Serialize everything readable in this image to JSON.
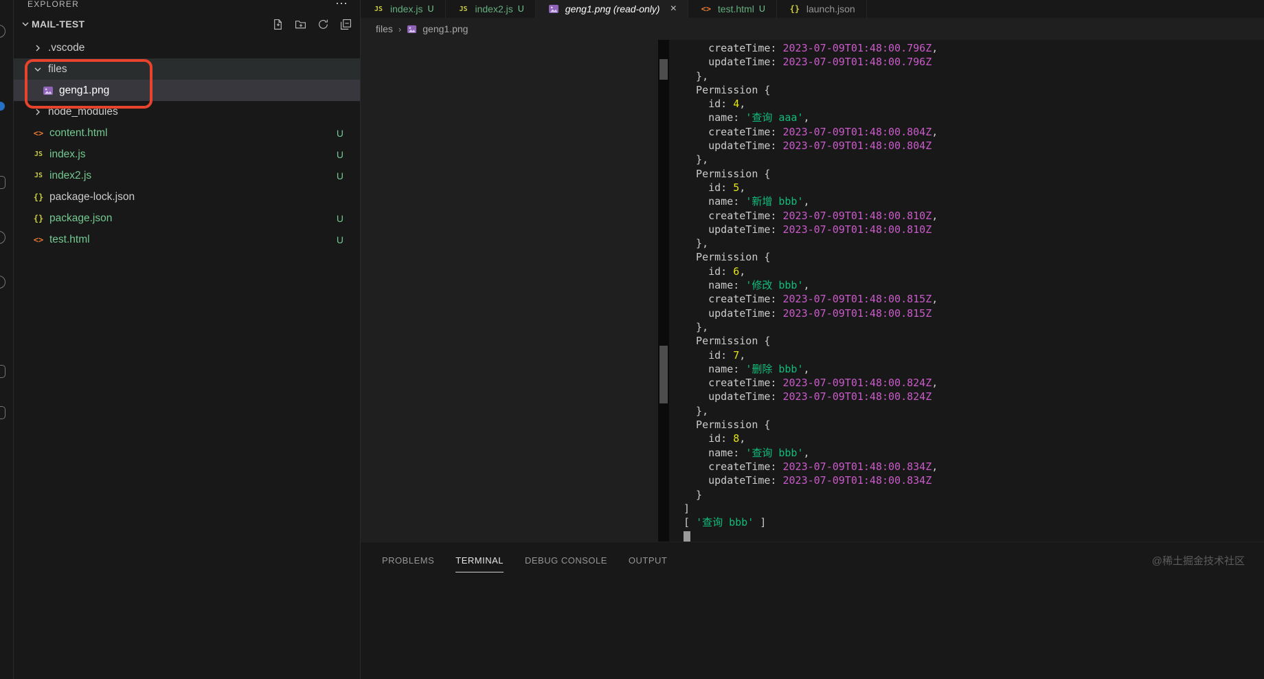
{
  "colors": {
    "untracked_green": "#73C991",
    "ansi_magenta": "#CB5BCB",
    "ansi_yellow": "#E5E510",
    "ansi_green": "#0FBE7C",
    "annotation_red": "#E8432D",
    "activity_badge_blue": "#2472C8",
    "selected_row": "#37373d"
  },
  "sidebar": {
    "header_label": "EXPLORER",
    "header_more": "⋯",
    "section_label": "MAIL-TEST",
    "toolbar": [
      "new-file",
      "new-folder",
      "refresh",
      "collapse-all"
    ],
    "files": [
      {
        "label": ".vscode",
        "type": "folder",
        "expanded": false
      },
      {
        "label": "files",
        "type": "folder",
        "expanded": true,
        "focused": true
      },
      {
        "label": "geng1.png",
        "type": "image",
        "indent": 2,
        "selected": true
      },
      {
        "label": "node_modules",
        "type": "folder",
        "expanded": false
      },
      {
        "label": "content.html",
        "type": "html",
        "badge": "U"
      },
      {
        "label": "index.js",
        "type": "js",
        "badge": "U"
      },
      {
        "label": "index2.js",
        "type": "js",
        "badge": "U"
      },
      {
        "label": "package-lock.json",
        "type": "json"
      },
      {
        "label": "package.json",
        "type": "json",
        "badge": "U"
      },
      {
        "label": "test.html",
        "type": "html",
        "badge": "U"
      }
    ]
  },
  "tabs": [
    {
      "label": "index.js",
      "icon": "js",
      "badge": "U",
      "active": false
    },
    {
      "label": "index2.js",
      "icon": "js",
      "badge": "U",
      "active": false
    },
    {
      "label": "geng1.png (read-only)",
      "icon": "image",
      "close": "×",
      "active": true
    },
    {
      "label": "test.html",
      "icon": "html",
      "badge": "U",
      "active": false
    },
    {
      "label": "launch.json",
      "icon": "json",
      "active": false
    }
  ],
  "breadcrumb": {
    "folder": "files",
    "separator": "›",
    "file": "geng1.png"
  },
  "terminal": {
    "lines": [
      {
        "segs": [
          [
            "f",
            "    createTime: "
          ],
          [
            "m",
            "2023-07-09T01:48:00.796Z"
          ],
          [
            "f",
            ","
          ]
        ]
      },
      {
        "segs": [
          [
            "f",
            "    updateTime: "
          ],
          [
            "m",
            "2023-07-09T01:48:00.796Z"
          ]
        ]
      },
      {
        "segs": [
          [
            "f",
            "  },"
          ]
        ]
      },
      {
        "segs": [
          [
            "f",
            "  Permission {"
          ]
        ]
      },
      {
        "segs": [
          [
            "f",
            "    id: "
          ],
          [
            "y",
            "4"
          ],
          [
            "f",
            ","
          ]
        ]
      },
      {
        "segs": [
          [
            "f",
            "    name: "
          ],
          [
            "g",
            "'查询 aaa'"
          ],
          [
            "f",
            ","
          ]
        ]
      },
      {
        "segs": [
          [
            "f",
            "    createTime: "
          ],
          [
            "m",
            "2023-07-09T01:48:00.804Z"
          ],
          [
            "f",
            ","
          ]
        ]
      },
      {
        "segs": [
          [
            "f",
            "    updateTime: "
          ],
          [
            "m",
            "2023-07-09T01:48:00.804Z"
          ]
        ]
      },
      {
        "segs": [
          [
            "f",
            "  },"
          ]
        ]
      },
      {
        "segs": [
          [
            "f",
            "  Permission {"
          ]
        ]
      },
      {
        "segs": [
          [
            "f",
            "    id: "
          ],
          [
            "y",
            "5"
          ],
          [
            "f",
            ","
          ]
        ]
      },
      {
        "segs": [
          [
            "f",
            "    name: "
          ],
          [
            "g",
            "'新增 bbb'"
          ],
          [
            "f",
            ","
          ]
        ]
      },
      {
        "segs": [
          [
            "f",
            "    createTime: "
          ],
          [
            "m",
            "2023-07-09T01:48:00.810Z"
          ],
          [
            "f",
            ","
          ]
        ]
      },
      {
        "segs": [
          [
            "f",
            "    updateTime: "
          ],
          [
            "m",
            "2023-07-09T01:48:00.810Z"
          ]
        ]
      },
      {
        "segs": [
          [
            "f",
            "  },"
          ]
        ]
      },
      {
        "segs": [
          [
            "f",
            "  Permission {"
          ]
        ]
      },
      {
        "segs": [
          [
            "f",
            "    id: "
          ],
          [
            "y",
            "6"
          ],
          [
            "f",
            ","
          ]
        ]
      },
      {
        "segs": [
          [
            "f",
            "    name: "
          ],
          [
            "g",
            "'修改 bbb'"
          ],
          [
            "f",
            ","
          ]
        ]
      },
      {
        "segs": [
          [
            "f",
            "    createTime: "
          ],
          [
            "m",
            "2023-07-09T01:48:00.815Z"
          ],
          [
            "f",
            ","
          ]
        ]
      },
      {
        "segs": [
          [
            "f",
            "    updateTime: "
          ],
          [
            "m",
            "2023-07-09T01:48:00.815Z"
          ]
        ]
      },
      {
        "segs": [
          [
            "f",
            "  },"
          ]
        ]
      },
      {
        "segs": [
          [
            "f",
            "  Permission {"
          ]
        ]
      },
      {
        "segs": [
          [
            "f",
            "    id: "
          ],
          [
            "y",
            "7"
          ],
          [
            "f",
            ","
          ]
        ]
      },
      {
        "segs": [
          [
            "f",
            "    name: "
          ],
          [
            "g",
            "'删除 bbb'"
          ],
          [
            "f",
            ","
          ]
        ]
      },
      {
        "segs": [
          [
            "f",
            "    createTime: "
          ],
          [
            "m",
            "2023-07-09T01:48:00.824Z"
          ],
          [
            "f",
            ","
          ]
        ]
      },
      {
        "segs": [
          [
            "f",
            "    updateTime: "
          ],
          [
            "m",
            "2023-07-09T01:48:00.824Z"
          ]
        ]
      },
      {
        "segs": [
          [
            "f",
            "  },"
          ]
        ]
      },
      {
        "segs": [
          [
            "f",
            "  Permission {"
          ]
        ]
      },
      {
        "segs": [
          [
            "f",
            "    id: "
          ],
          [
            "y",
            "8"
          ],
          [
            "f",
            ","
          ]
        ]
      },
      {
        "segs": [
          [
            "f",
            "    name: "
          ],
          [
            "g",
            "'查询 bbb'"
          ],
          [
            "f",
            ","
          ]
        ]
      },
      {
        "segs": [
          [
            "f",
            "    createTime: "
          ],
          [
            "m",
            "2023-07-09T01:48:00.834Z"
          ],
          [
            "f",
            ","
          ]
        ]
      },
      {
        "segs": [
          [
            "f",
            "    updateTime: "
          ],
          [
            "m",
            "2023-07-09T01:48:00.834Z"
          ]
        ]
      },
      {
        "segs": [
          [
            "f",
            "  }"
          ]
        ]
      },
      {
        "segs": [
          [
            "f",
            "]"
          ]
        ]
      },
      {
        "segs": [
          [
            "f",
            "[ "
          ],
          [
            "g",
            "'查询 bbb'"
          ],
          [
            "f",
            " ]"
          ]
        ]
      },
      {
        "cursor": true
      }
    ]
  },
  "panel": {
    "tabs": [
      "PROBLEMS",
      "TERMINAL",
      "DEBUG CONSOLE",
      "OUTPUT"
    ],
    "active": "TERMINAL",
    "watermark": "@稀土掘金技术社区"
  }
}
